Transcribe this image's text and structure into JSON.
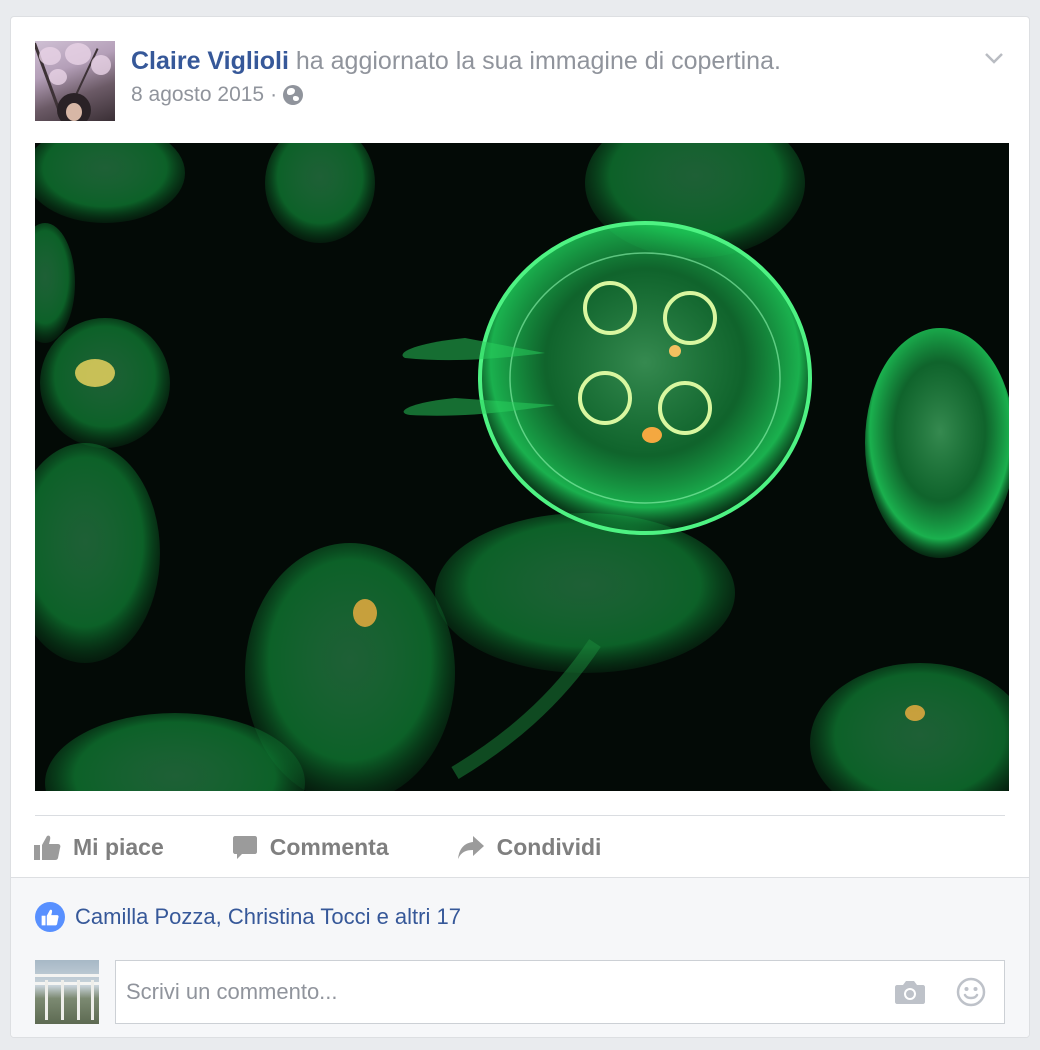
{
  "post": {
    "author": "Claire Viglioli",
    "action_text": "ha aggiornato la sua immagine di copertina.",
    "date": "8 agosto 2015",
    "separator": "·",
    "privacy_icon": "globe-icon",
    "menu_icon": "chevron-down-icon",
    "photo_subject": "green-jellyfish-photo"
  },
  "actions": {
    "like": "Mi piace",
    "comment": "Commenta",
    "share": "Condividi"
  },
  "reactions": {
    "text": "Camilla Pozza, Christina Tocci e altri 17",
    "icon": "thumbs-up-icon"
  },
  "comment_box": {
    "placeholder": "Scrivi un commento...",
    "value": "",
    "camera_icon": "camera-icon",
    "emoji_icon": "smiley-icon"
  },
  "colors": {
    "link": "#365899",
    "muted": "#90949c",
    "action_gray": "#7f7f7f",
    "like_blue": "#5890ff",
    "jelly_green": "#2ee66a"
  }
}
